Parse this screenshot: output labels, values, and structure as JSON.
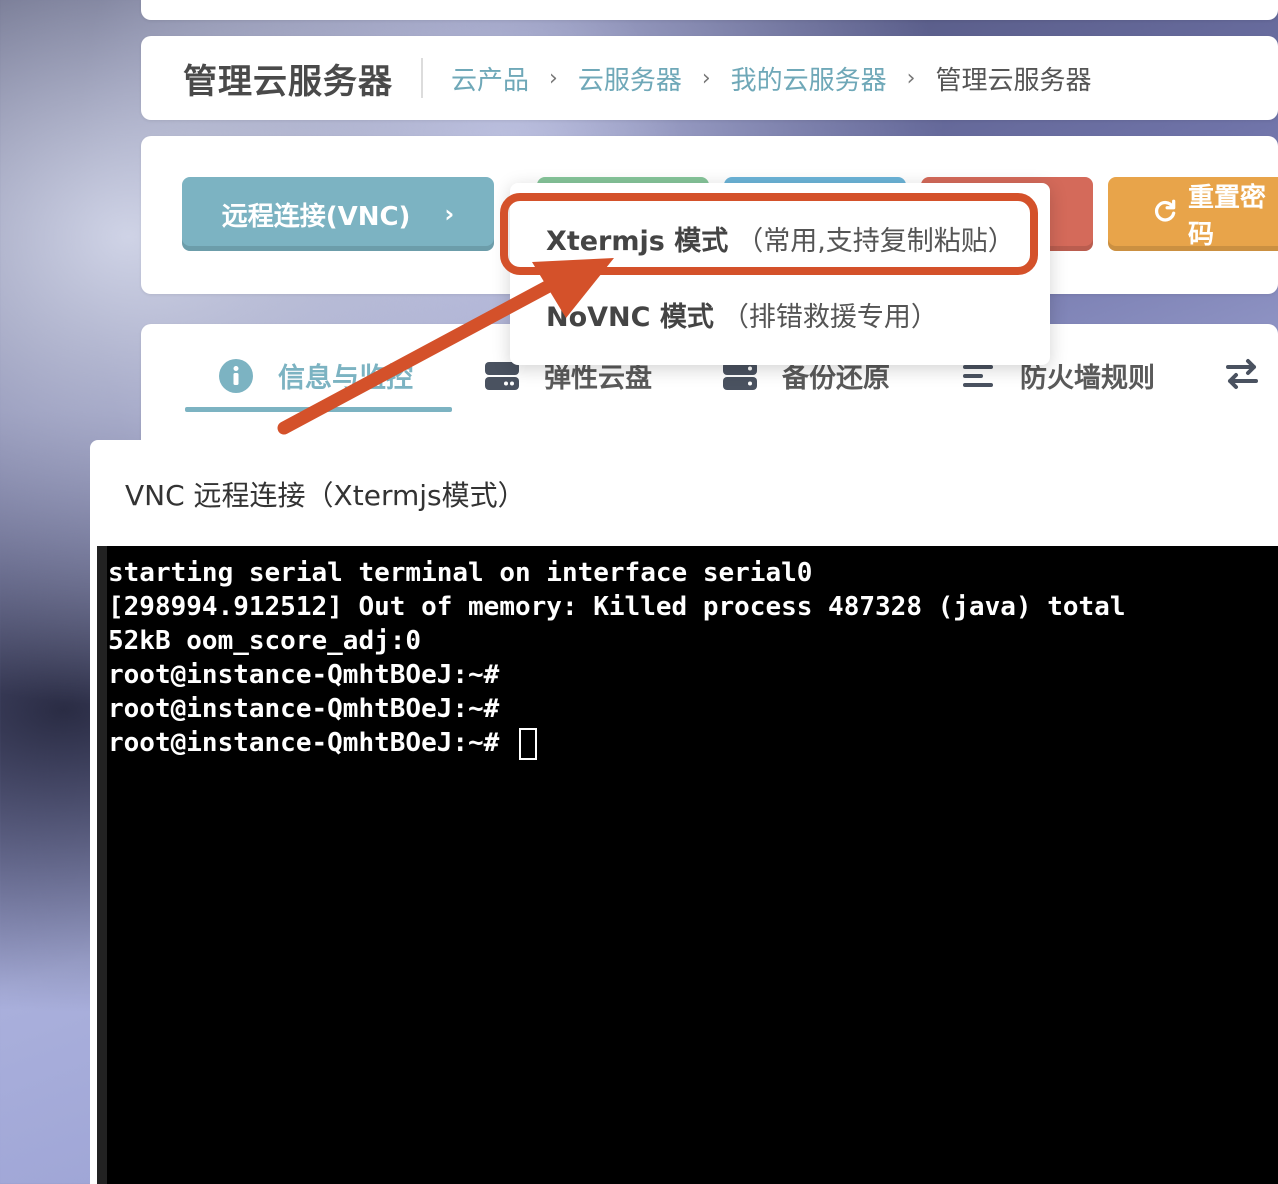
{
  "header": {
    "page_title": "管理云服务器",
    "breadcrumb": [
      {
        "label": "云产品"
      },
      {
        "label": "云服务器"
      },
      {
        "label": "我的云服务器"
      },
      {
        "label": "管理云服务器"
      }
    ],
    "separator": "›"
  },
  "actions": {
    "vnc_label": "远程连接(VNC)",
    "vnc_chevron": "›",
    "reset_password_label": "重置密码",
    "reset_icon": "refresh-icon"
  },
  "dropdown": {
    "items": [
      {
        "mode": "Xtermjs 模式",
        "hint": "（常用,支持复制粘贴）"
      },
      {
        "mode": "NoVNC 模式",
        "hint": "（排错救援专用）"
      }
    ]
  },
  "tabs": [
    {
      "label": "信息与监控",
      "icon": "info-icon",
      "active": true
    },
    {
      "label": "弹性云盘",
      "icon": "disk-icon"
    },
    {
      "label": "备份还原",
      "icon": "server-icon"
    },
    {
      "label": "防火墙规则",
      "icon": "list-icon"
    },
    {
      "label": "",
      "icon": "swap-icon"
    }
  ],
  "vnc_panel": {
    "title": "VNC 远程连接（Xtermjs模式）"
  },
  "terminal": {
    "lines": [
      "starting serial terminal on interface serial0",
      "[298994.912512] Out of memory: Killed process 487328 (java) total",
      "52kB oom_score_adj:0",
      "root@instance-QmhtBOeJ:~#",
      "root@instance-QmhtBOeJ:~#",
      "root@instance-QmhtBOeJ:~# "
    ]
  },
  "colors": {
    "accent": "#7cb3c2",
    "annotation": "#d4512a",
    "btn_green": "#86c59a",
    "btn_blue": "#6cb4d8",
    "btn_red": "#d46a5a",
    "btn_orange": "#e8a44a"
  }
}
